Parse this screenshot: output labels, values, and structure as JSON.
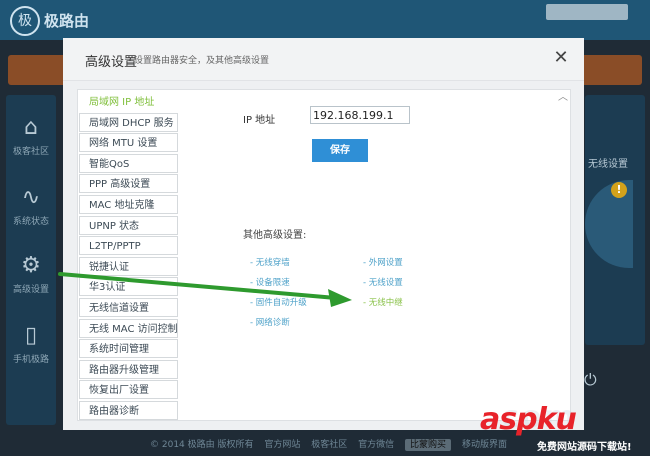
{
  "app": {
    "logo_text": "极路由",
    "footer": {
      "copyright": "© 2014 极路由 版权所有",
      "official_site": "官方网站",
      "community": "极客社区",
      "wechat": "官方微信",
      "tag": "比蒙购买",
      "mobile": "移动版界面"
    },
    "sidebar": {
      "items": [
        {
          "label": "极客社区",
          "icon": "home-icon"
        },
        {
          "label": "系统状态",
          "icon": "pulse-icon"
        },
        {
          "label": "高级设置",
          "icon": "gear-icon"
        },
        {
          "label": "手机极路",
          "icon": "phone-icon"
        }
      ]
    },
    "right_panel": {
      "label": "无线设置"
    },
    "warn_badge": "!"
  },
  "modal": {
    "title": "高级设置",
    "subtitle": "设置路由器安全，及其他高级设置",
    "close": "✕",
    "menu": [
      {
        "label": "局域网 IP 地址",
        "active": true
      },
      {
        "label": "局域网 DHCP 服务",
        "active": false
      },
      {
        "label": "网络 MTU 设置",
        "active": false
      },
      {
        "label": "智能QoS",
        "active": false
      },
      {
        "label": "PPP 高级设置",
        "active": false
      },
      {
        "label": "MAC 地址克隆",
        "active": false
      },
      {
        "label": "UPNP 状态",
        "active": false
      },
      {
        "label": "L2TP/PPTP",
        "active": false
      },
      {
        "label": "锐捷认证",
        "active": false
      },
      {
        "label": "华3认证",
        "active": false
      },
      {
        "label": "无线信道设置",
        "active": false
      },
      {
        "label": "无线 MAC 访问控制",
        "active": false
      },
      {
        "label": "系统时间管理",
        "active": false
      },
      {
        "label": "路由器升级管理",
        "active": false
      },
      {
        "label": "恢复出厂设置",
        "active": false
      },
      {
        "label": "路由器诊断",
        "active": false
      }
    ],
    "ip_label": "IP 地址",
    "ip_value": "192.168.199.1",
    "save_label": "保存",
    "other_title": "其他高级设置:",
    "links_left": [
      "- 无线穿墙",
      "- 设备限速",
      "- 固件自动升级",
      "- 网络诊断"
    ],
    "links_right": [
      "- 外网设置",
      "- 无线设置",
      "- 无线中继"
    ]
  },
  "watermark": {
    "brand": "aspku",
    "tld": ".com",
    "sub": "免费网站源码下载站!"
  },
  "colors": {
    "accent_blue": "#2f8fd6",
    "active_green": "#7fbf3a",
    "arrow_green": "#2e9a2e",
    "watermark_red": "#e8232a"
  }
}
